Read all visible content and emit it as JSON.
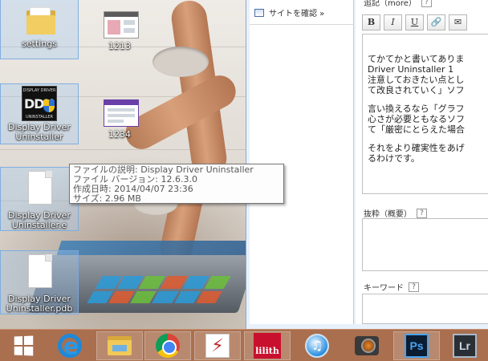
{
  "desktop": {
    "icons": [
      {
        "label": "settings"
      },
      {
        "label": "1213"
      },
      {
        "label": "Display Driver Uninstaller"
      },
      {
        "label": "1234"
      },
      {
        "label": "Display Driver Uninstaller.e"
      },
      {
        "label": "Display Driver Uninstaller.pdb"
      }
    ],
    "ddu_logo": {
      "top": "DISPLAY DRIVER",
      "big": "DDU",
      "bottom": "UNINSTALLER"
    }
  },
  "tooltip": {
    "line1": "ファイルの説明: Display Driver Uninstaller",
    "line2": "ファイル バージョン: 12.6.3.0",
    "line3": "作成日時: 2014/04/07 23:36",
    "line4": "サイズ: 2.96 MB"
  },
  "browser": {
    "site_button": "サイトを確認 »",
    "body_label": "追記（more）",
    "body_help": "?",
    "toolbar": {
      "bold": "B",
      "italic": "I",
      "underline": "U",
      "link": "🔗",
      "mail": "✉"
    },
    "editor_lines": [
      "てかてかと書いてありま",
      "Driver Uninstaller 1",
      "注意しておきたい点とし",
      "て改良されていく」ソフ",
      "",
      "言い換えるなら「グラフ",
      "心さが必要ともなるソフ",
      "て「厳密にとらえた場合",
      "",
      "それをより確実性をあげ",
      "るわけです。"
    ],
    "excerpt_label": "抜粋（概要）",
    "excerpt_help": "?",
    "keyword_label": "キーワード",
    "keyword_help": "?"
  },
  "taskbar": {
    "apps": [
      {
        "name": "start"
      },
      {
        "name": "internet-explorer"
      },
      {
        "name": "file-explorer"
      },
      {
        "name": "chrome"
      },
      {
        "name": "red-app"
      },
      {
        "name": "lilith",
        "label": "lilith"
      },
      {
        "name": "itunes"
      },
      {
        "name": "camera"
      },
      {
        "name": "photoshop",
        "label": "Ps"
      },
      {
        "name": "lightroom",
        "label": "Lr"
      }
    ]
  }
}
